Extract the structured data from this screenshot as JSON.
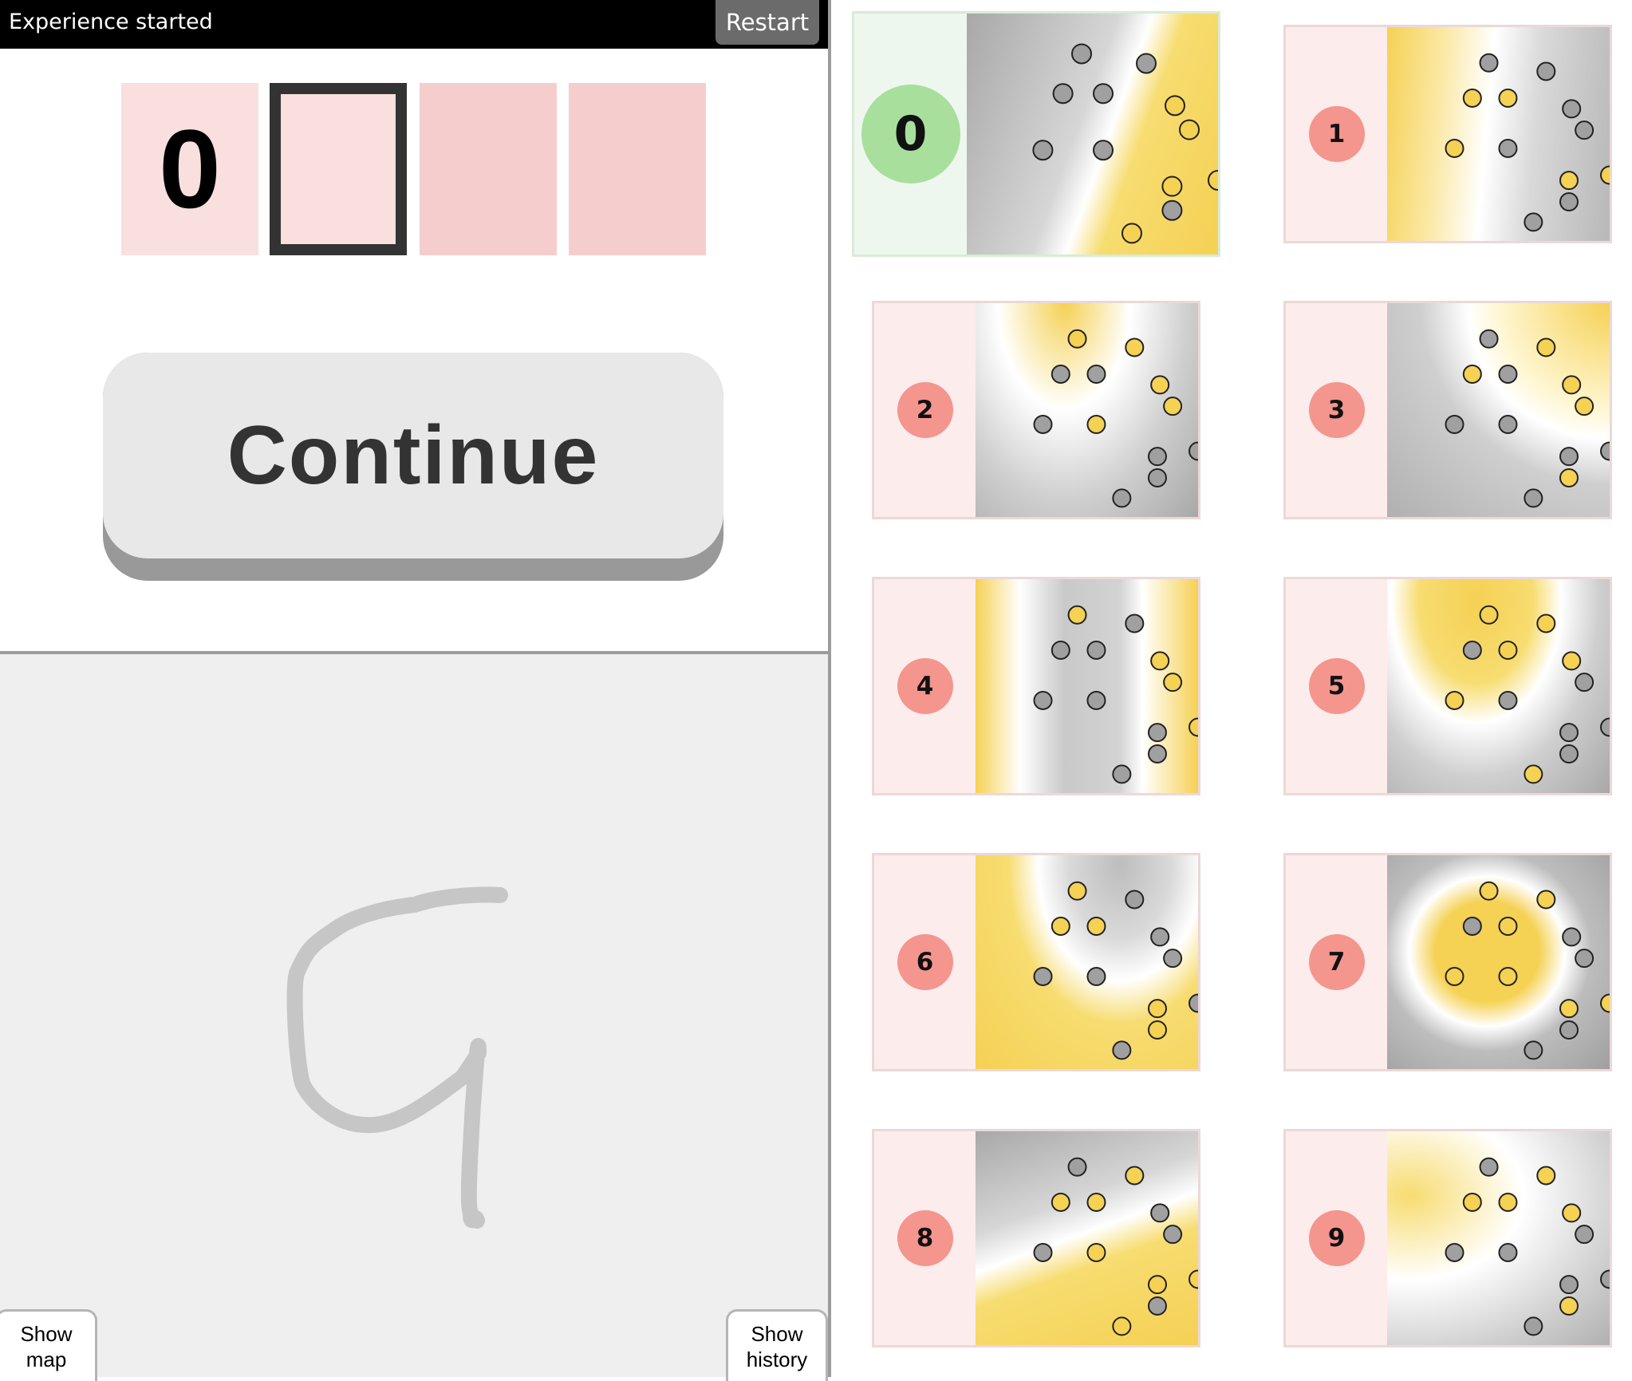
{
  "topbar": {
    "status": "Experience started",
    "restart_label": "Restart"
  },
  "slots": [
    "0",
    "",
    "",
    ""
  ],
  "continue_label": "Continue",
  "tabs": {
    "map": "Show\nmap",
    "history": "Show\nhistory"
  },
  "cards": [
    {
      "label": "0",
      "active": true
    },
    {
      "label": "1",
      "active": false
    },
    {
      "label": "2",
      "active": false
    },
    {
      "label": "3",
      "active": false
    },
    {
      "label": "4",
      "active": false
    },
    {
      "label": "5",
      "active": false
    },
    {
      "label": "6",
      "active": false
    },
    {
      "label": "7",
      "active": false
    },
    {
      "label": "8",
      "active": false
    },
    {
      "label": "9",
      "active": false
    }
  ],
  "colors": {
    "gold": "#f5d154",
    "gray": "#a0a0a0",
    "badge": "#f4958e",
    "badge_active": "#a8df9d"
  }
}
